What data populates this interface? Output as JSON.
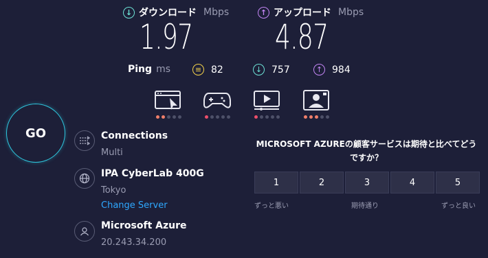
{
  "download": {
    "label": "ダウンロード",
    "unit": "Mbps",
    "value": "1.97"
  },
  "upload": {
    "label": "アップロード",
    "unit": "Mbps",
    "value": "4.87"
  },
  "ping": {
    "label": "Ping",
    "unit": "ms",
    "idle": "82",
    "download": "757",
    "upload": "984"
  },
  "activities": [
    {
      "icon": "web-browsing-icon",
      "level": 2
    },
    {
      "icon": "gaming-controller-icon",
      "level": 1
    },
    {
      "icon": "video-streaming-icon",
      "level": 1
    },
    {
      "icon": "video-call-icon",
      "level": 3
    }
  ],
  "go_button": {
    "label": "GO"
  },
  "connections": {
    "title": "Connections",
    "value": "Multi"
  },
  "server": {
    "title": "IPA CyberLab 400G",
    "location": "Tokyo",
    "change_label": "Change Server"
  },
  "isp": {
    "title": "Microsoft Azure",
    "ip": "20.243.34.200"
  },
  "survey": {
    "question": "MICROSOFT AZUREの顧客サービスは期待と比べてどうですか？",
    "options": [
      "1",
      "2",
      "3",
      "4",
      "5"
    ],
    "label_low": "ずっと悪い",
    "label_mid": "期待通り",
    "label_high": "ずっと良い"
  },
  "colors": {
    "background": "#1d1f38",
    "download": "#6de3d6",
    "upload": "#c486f5",
    "accent": "#2ec9e0",
    "link": "#2ea8ff"
  }
}
